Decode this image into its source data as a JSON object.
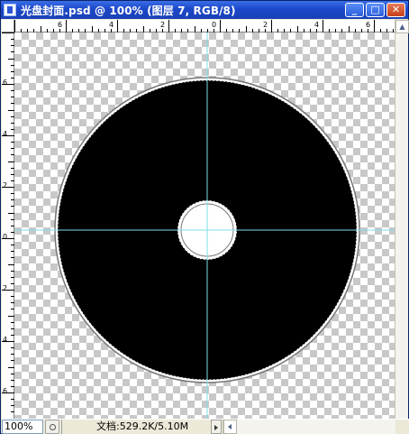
{
  "window": {
    "title": "光盘封面.psd @ 100% (图层 7, RGB/8)",
    "minimize_label": "_",
    "maximize_label": "□",
    "close_label": "✕"
  },
  "rulers": {
    "horizontal_labels": [
      "6",
      "4",
      "2",
      "0",
      "2",
      "4",
      "6"
    ],
    "vertical_labels": [
      "6",
      "4",
      "2",
      "0",
      "2",
      "4",
      "6"
    ]
  },
  "canvas": {
    "shape_color": "#000000",
    "guide_color": "#7fdde8",
    "checker_color": "#c8c8c8"
  },
  "status": {
    "zoom": "100%",
    "doc_info": "文档:529.2K/5.10M"
  },
  "icons": {
    "app": "photoshop-document-icon",
    "status_menu": "status-menu-icon",
    "scroll_left": "scroll-left-arrow-icon",
    "scroll_up": "scroll-up-arrow-icon"
  }
}
